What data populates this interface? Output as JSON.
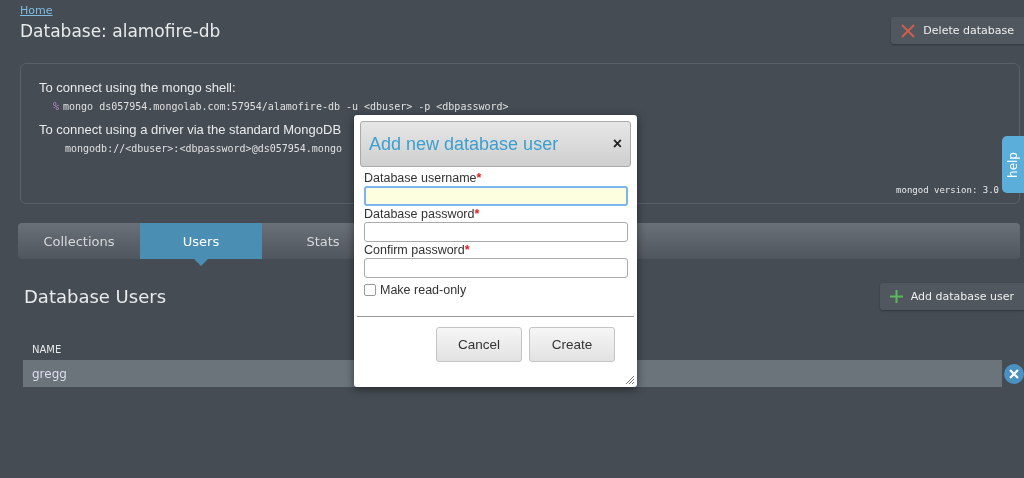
{
  "breadcrumb": "Home",
  "title": "Database: alamofire-db",
  "delete_button": "Delete database",
  "connection": {
    "shell_label": "To connect using the mongo shell:",
    "shell_prompt": "%",
    "shell_command": "mongo ds057954.mongolab.com:57954/alamofire-db -u <dbuser> -p <dbpassword>",
    "driver_label": "To connect using a driver via the standard MongoDB",
    "driver_uri": "mongodb://<dbuser>:<dbpassword>@ds057954.mongo",
    "version": "mongod version: 3.0"
  },
  "tabs": [
    {
      "label": "Collections",
      "selected": false
    },
    {
      "label": "Users",
      "selected": true
    },
    {
      "label": "Stats",
      "selected": false
    }
  ],
  "section_title": "Database Users",
  "add_button": "Add database user",
  "table": {
    "columns": [
      "NAME"
    ],
    "rows": [
      {
        "name": "gregg"
      }
    ]
  },
  "help_tab": "help",
  "dialog": {
    "title": "Add new database user",
    "close": "×",
    "fields": [
      {
        "label": "Database username",
        "required": "*",
        "focused": true
      },
      {
        "label": "Database password",
        "required": "*",
        "focused": false
      },
      {
        "label": "Confirm password",
        "required": "*",
        "focused": false
      }
    ],
    "checkbox": {
      "label": "Make read-only",
      "checked": false
    },
    "buttons": [
      "Cancel",
      "Create"
    ]
  }
}
